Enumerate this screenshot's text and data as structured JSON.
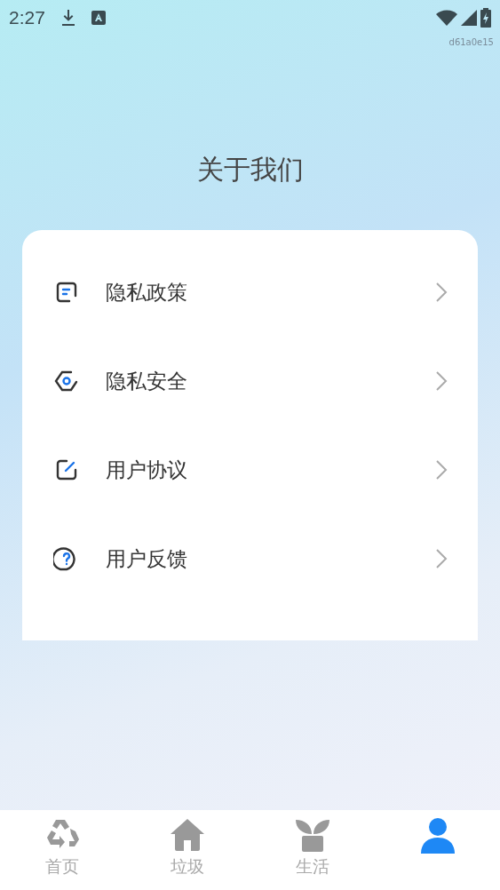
{
  "status_bar": {
    "time": "2:27",
    "build_id": "d61a0e15"
  },
  "title": "关于我们",
  "menu": [
    {
      "kind": "doc",
      "label": "隐私政策"
    },
    {
      "kind": "shield",
      "label": "隐私安全"
    },
    {
      "kind": "edit",
      "label": "用户协议"
    },
    {
      "kind": "help",
      "label": "用户反馈"
    }
  ],
  "tabs": [
    {
      "kind": "recycle",
      "label": "首页",
      "selected": false
    },
    {
      "kind": "home",
      "label": "垃圾",
      "selected": false
    },
    {
      "kind": "plant",
      "label": "生活",
      "selected": false
    },
    {
      "kind": "user",
      "selected": true
    }
  ]
}
